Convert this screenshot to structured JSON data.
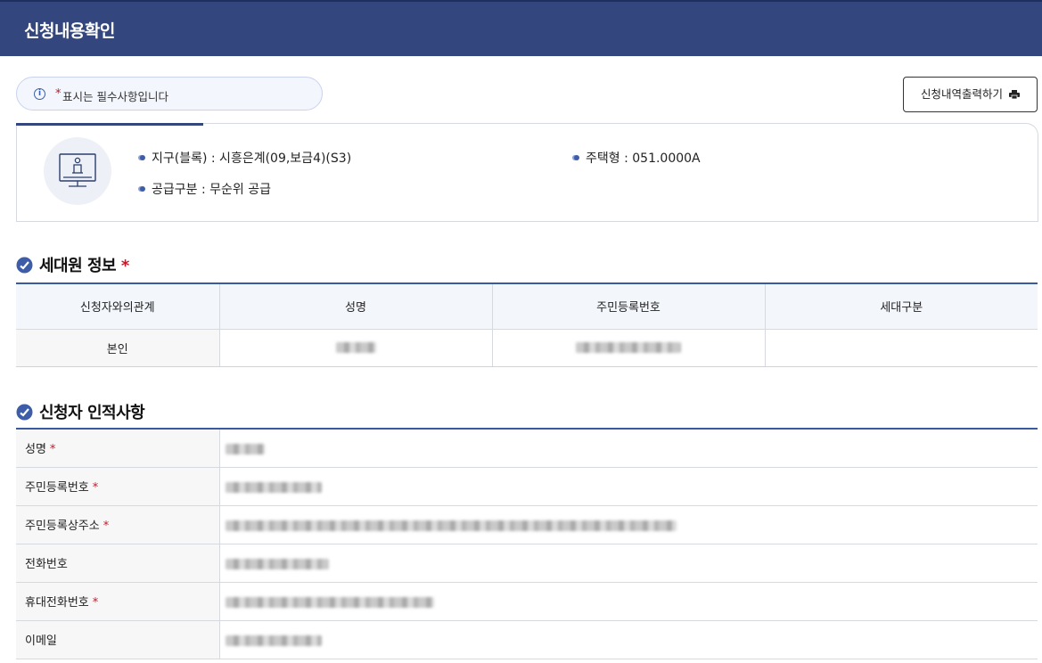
{
  "header": {
    "title": "신청내용확인"
  },
  "notice": {
    "required_mark": "*",
    "text": "표시는 필수사항입니다"
  },
  "toolbar": {
    "print_label": "신청내역출력하기"
  },
  "summary": {
    "district": "지구(블록) : 시흥은계(09,보금4)(S3)",
    "housing_type": "주택형 : 051.0000A",
    "supply_type": "공급구분 : 무순위 공급"
  },
  "household": {
    "title": "세대원 정보",
    "required_mark": "*",
    "columns": [
      "신청자와의관계",
      "성명",
      "주민등록번호",
      "세대구분"
    ],
    "rows": [
      {
        "relation": "본인",
        "name": "",
        "rrn": "",
        "household_type": ""
      }
    ]
  },
  "applicant": {
    "title": "신청자 인적사항",
    "required_mark": "*",
    "rows": [
      {
        "label": "성명",
        "required": true
      },
      {
        "label": "주민등록번호",
        "required": true
      },
      {
        "label": "주민등록상주소",
        "required": true
      },
      {
        "label": "전화번호",
        "required": false
      },
      {
        "label": "휴대전화번호",
        "required": true
      },
      {
        "label": "이메일",
        "required": false
      }
    ]
  },
  "colors": {
    "header_bg": "#33467d",
    "accent": "#3d5da9",
    "required": "#c0192d"
  }
}
